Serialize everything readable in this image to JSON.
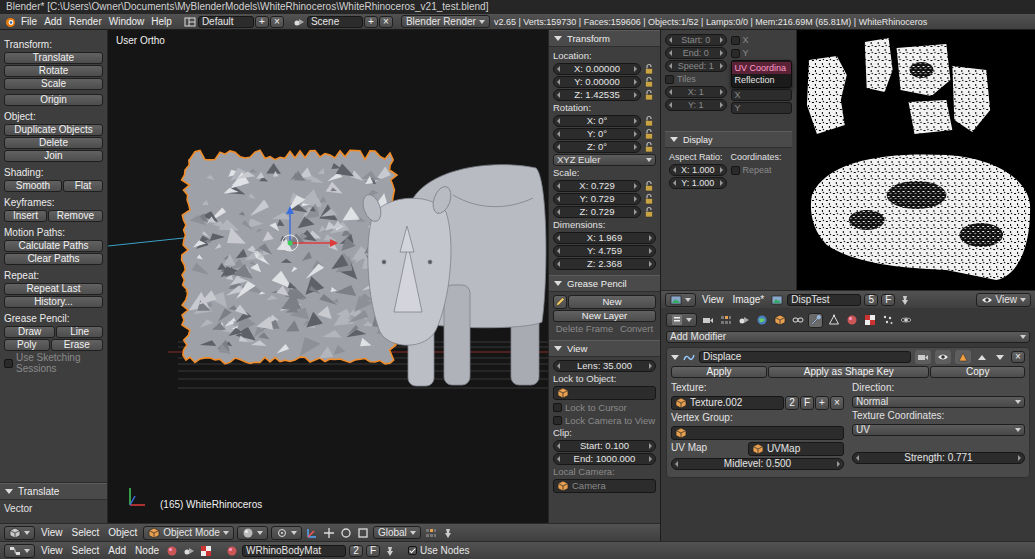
{
  "window": {
    "title": "Blender* [C:\\Users\\Owner\\Documents\\MyBlenderModels\\WhiteRhinoceros\\WhiteRhinoceros_v21_test.blend]"
  },
  "menubar": {
    "menus": [
      "File",
      "Add",
      "Render",
      "Window",
      "Help"
    ],
    "layout": "Default",
    "layout_add": "+",
    "layout_remove": "×",
    "scene": "Scene",
    "scene_add": "+",
    "scene_remove": "×",
    "engine": "Blender Render",
    "info": "v2.65 | Verts:159730 | Faces:159606 | Objects:1/52 | Lamps:0/0 | Mem:216.69M (65.81M) | WhiteRhinoceros"
  },
  "toolshelf": {
    "groups": [
      [
        [
          {
            "kind": "heading",
            "text": "Transform:",
            "disabled": false
          }
        ],
        [
          {
            "kind": "button",
            "text": "Translate",
            "disabled": false
          }
        ],
        [
          {
            "kind": "button",
            "text": "Rotate",
            "disabled": false
          }
        ],
        [
          {
            "kind": "button",
            "text": "Scale",
            "disabled": false
          }
        ]
      ],
      [
        [
          {
            "kind": "button",
            "text": "Origin",
            "disabled": false
          }
        ]
      ],
      [
        [
          {
            "kind": "heading",
            "text": "Object:",
            "disabled": false
          }
        ],
        [
          {
            "kind": "button",
            "text": "Duplicate Objects",
            "disabled": false
          }
        ],
        [
          {
            "kind": "button",
            "text": "Delete",
            "disabled": false
          }
        ],
        [
          {
            "kind": "button",
            "text": "Join",
            "disabled": false
          }
        ]
      ],
      [
        [
          {
            "kind": "heading",
            "text": "Shading:",
            "disabled": false
          }
        ],
        [
          {
            "kind": "button",
            "text": "Smooth",
            "disabled": false
          },
          {
            "kind": "button",
            "text": "Flat",
            "disabled": false
          }
        ]
      ],
      [
        [
          {
            "kind": "heading",
            "text": "Keyframes:",
            "disabled": false
          }
        ],
        [
          {
            "kind": "button",
            "text": "Insert",
            "disabled": false
          },
          {
            "kind": "button",
            "text": "Remove",
            "disabled": false
          }
        ]
      ],
      [
        [
          {
            "kind": "heading",
            "text": "Motion Paths:",
            "disabled": false
          }
        ],
        [
          {
            "kind": "button",
            "text": "Calculate Paths",
            "disabled": false
          }
        ],
        [
          {
            "kind": "button",
            "text": "Clear Paths",
            "disabled": false
          }
        ]
      ],
      [
        [
          {
            "kind": "heading",
            "text": "Repeat:",
            "disabled": false
          }
        ],
        [
          {
            "kind": "button",
            "text": "Repeat Last",
            "disabled": false
          }
        ],
        [
          {
            "kind": "button",
            "text": "History...",
            "disabled": false
          }
        ]
      ],
      [
        [
          {
            "kind": "heading",
            "text": "Grease Pencil:",
            "disabled": false
          }
        ],
        [
          {
            "kind": "button",
            "text": "Draw",
            "disabled": false
          },
          {
            "kind": "button",
            "text": "Line",
            "disabled": false
          }
        ],
        [
          {
            "kind": "button",
            "text": "Poly",
            "disabled": false
          },
          {
            "kind": "button",
            "text": "Erase",
            "disabled": false
          }
        ],
        [
          {
            "kind": "check",
            "text": "Use Sketching Sessions",
            "checked": false,
            "disabled": true
          }
        ]
      ]
    ],
    "operator_panel": {
      "title": "Translate",
      "expanded": true,
      "rows": [
        [
          {
            "kind": "label",
            "text": "Vector",
            "disabled": false
          }
        ]
      ]
    }
  },
  "viewport": {
    "view_name": "User Ortho",
    "object_label": "(165) WhiteRhinoceros"
  },
  "sidebar": {
    "panels": [
      {
        "title": "Transform",
        "expanded": true,
        "rows": [
          [
            {
              "kind": "label",
              "text": "Location:",
              "disabled": false
            }
          ],
          [
            {
              "kind": "number",
              "text": "X: 0.00000",
              "disabled": false,
              "locked": false
            }
          ],
          [
            {
              "kind": "number",
              "text": "Y: 0.00000",
              "disabled": false,
              "locked": false
            }
          ],
          [
            {
              "kind": "number",
              "text": "Z: 1.42535",
              "disabled": false,
              "locked": false
            }
          ],
          [
            {
              "kind": "label",
              "text": "Rotation:",
              "disabled": false
            }
          ],
          [
            {
              "kind": "number",
              "text": "X: 0°",
              "disabled": false,
              "locked": false
            }
          ],
          [
            {
              "kind": "number",
              "text": "Y: 0°",
              "disabled": false,
              "locked": false
            }
          ],
          [
            {
              "kind": "number",
              "text": "Z: 0°",
              "disabled": false,
              "locked": false
            }
          ],
          [
            {
              "kind": "menu",
              "text": "XYZ Euler",
              "disabled": false
            }
          ],
          [
            {
              "kind": "label",
              "text": "Scale:",
              "disabled": false
            }
          ],
          [
            {
              "kind": "number",
              "text": "X: 0.729",
              "disabled": false,
              "locked": false
            }
          ],
          [
            {
              "kind": "number",
              "text": "Y: 0.729",
              "disabled": false,
              "locked": false
            }
          ],
          [
            {
              "kind": "number",
              "text": "Z: 0.729",
              "disabled": false,
              "locked": false
            }
          ],
          [
            {
              "kind": "label",
              "text": "Dimensions:",
              "disabled": false
            }
          ],
          [
            {
              "kind": "number",
              "text": "X: 1.969",
              "disabled": false
            }
          ],
          [
            {
              "kind": "number",
              "text": "Y: 4.759",
              "disabled": false
            }
          ],
          [
            {
              "kind": "number",
              "text": "Z: 2.368",
              "disabled": false
            }
          ]
        ]
      },
      {
        "title": "Grease Pencil",
        "expanded": true,
        "rows": [
          [
            {
              "kind": "iconbutton",
              "disabled": false
            },
            {
              "kind": "button",
              "text": "New",
              "disabled": false
            }
          ],
          [
            {
              "kind": "button",
              "text": "New Layer",
              "disabled": false
            }
          ],
          [
            {
              "kind": "button",
              "text": "Delete Frame",
              "disabled": true
            },
            {
              "kind": "button",
              "text": "Convert",
              "disabled": true
            }
          ]
        ]
      },
      {
        "title": "View",
        "expanded": true,
        "rows": [
          [
            {
              "kind": "number",
              "text": "Lens: 35.000",
              "disabled": false
            }
          ],
          [
            {
              "kind": "label",
              "text": "Lock to Object:",
              "disabled": false
            }
          ],
          [
            {
              "kind": "idfield",
              "text": "",
              "disabled": false
            }
          ],
          [
            {
              "kind": "check",
              "text": "Lock to Cursor",
              "checked": false,
              "disabled": true
            }
          ],
          [
            {
              "kind": "check",
              "text": "Lock Camera to View",
              "checked": false,
              "disabled": true
            }
          ],
          [
            {
              "kind": "label",
              "text": "Clip:",
              "disabled": false
            }
          ],
          [
            {
              "kind": "number",
              "text": "Start: 0.100",
              "disabled": false
            }
          ],
          [
            {
              "kind": "number",
              "text": "End: 1000.000",
              "disabled": false
            }
          ],
          [
            {
              "kind": "label",
              "text": "Local Camera:",
              "disabled": true
            }
          ],
          [
            {
              "kind": "idfield",
              "text": "Camera",
              "disabled": true
            }
          ]
        ]
      }
    ]
  },
  "viewport_header": {
    "menus": [
      "View",
      "Select",
      "Object"
    ],
    "mode": "Object Mode",
    "orientation": "Global"
  },
  "image_panel": {
    "left": [
      [
        {
          "kind": "number",
          "text": "Start: 0",
          "disabled": true
        }
      ],
      [
        {
          "kind": "number",
          "text": "End: 0",
          "disabled": true
        }
      ],
      [
        {
          "kind": "number",
          "text": "Speed: 1",
          "disabled": true
        }
      ],
      [
        {
          "kind": "check",
          "text": "Tiles",
          "checked": false,
          "disabled": true
        }
      ],
      [
        {
          "kind": "number",
          "text": "X: 1",
          "disabled": true
        }
      ],
      [
        {
          "kind": "number",
          "text": "Y: 1",
          "disabled": true
        }
      ]
    ],
    "right": [
      [
        {
          "kind": "check",
          "text": "X",
          "checked": false,
          "disabled": true
        }
      ],
      [
        {
          "kind": "check",
          "text": "Y",
          "checked": false,
          "disabled": true
        }
      ],
      [
        {
          "kind": "popup",
          "items": [
            {
              "text": "UV Coordina",
              "selected": true
            },
            {
              "text": "Reflection",
              "selected": false
            }
          ]
        }
      ],
      [
        {
          "kind": "field",
          "text": "X",
          "disabled": true
        }
      ],
      [
        {
          "kind": "field",
          "text": "Y",
          "disabled": true
        }
      ]
    ],
    "display": {
      "title": "Display",
      "expanded": true,
      "left": [
        [
          {
            "kind": "label",
            "text": "Aspect Ratio:",
            "disabled": false
          }
        ],
        [
          {
            "kind": "number",
            "text": "X: 1.000",
            "disabled": false
          }
        ],
        [
          {
            "kind": "number",
            "text": "Y: 1.000",
            "disabled": false
          }
        ]
      ],
      "right": [
        [
          {
            "kind": "label",
            "text": "Coordinates:",
            "disabled": false
          }
        ],
        [
          {
            "kind": "check",
            "text": "Repeat",
            "checked": false,
            "disabled": true
          }
        ]
      ]
    }
  },
  "image_header": {
    "menus": [
      "View",
      "Image*"
    ],
    "image": "DispTest",
    "users": "5",
    "fake": "F",
    "display": "View"
  },
  "properties": {
    "tabs": [
      {
        "selected": false
      },
      {
        "selected": false
      },
      {
        "selected": false
      },
      {
        "selected": false
      },
      {
        "selected": false
      },
      {
        "selected": false
      },
      {
        "selected": true
      },
      {
        "selected": false
      },
      {
        "selected": false
      },
      {
        "selected": false
      },
      {
        "selected": false
      },
      {
        "selected": false
      }
    ],
    "add_modifier": "Add Modifier",
    "modifier": {
      "name": "Displace",
      "expanded": true,
      "toggles": [
        {
          "on": true
        },
        {
          "on": true
        },
        {
          "on": true
        }
      ],
      "remove": "×",
      "actions": [
        {
          "kind": "button",
          "text": "Apply",
          "disabled": false
        },
        {
          "kind": "button",
          "text": "Apply as Shape Key",
          "disabled": false
        },
        {
          "kind": "button",
          "text": "Copy",
          "disabled": false
        }
      ],
      "left": [
        [
          {
            "kind": "label",
            "text": "Texture:",
            "disabled": false
          }
        ],
        [
          {
            "kind": "idfield",
            "text": "Texture.002",
            "disabled": false
          },
          {
            "kind": "button",
            "text": "2",
            "disabled": false
          },
          {
            "kind": "button",
            "text": "F",
            "disabled": false
          },
          {
            "kind": "button",
            "text": "+",
            "disabled": false
          },
          {
            "kind": "button",
            "text": "×",
            "disabled": false
          }
        ],
        [
          {
            "kind": "label",
            "text": "Vertex Group:",
            "disabled": false
          }
        ],
        [
          {
            "kind": "idfield",
            "text": "",
            "disabled": false
          }
        ],
        [
          {
            "kind": "label",
            "text": "UV Map",
            "disabled": false
          },
          {
            "kind": "idfield",
            "text": "UVMap",
            "disabled": false
          }
        ],
        [
          {
            "kind": "number",
            "text": "Midlevel: 0.500",
            "disabled": false
          }
        ]
      ],
      "right": [
        [
          {
            "kind": "label",
            "text": "Direction:",
            "disabled": false
          }
        ],
        [
          {
            "kind": "menu",
            "text": "Normal",
            "disabled": false
          }
        ],
        [
          {
            "kind": "label",
            "text": "Texture Coordinates:",
            "disabled": false
          }
        ],
        [
          {
            "kind": "menu",
            "text": "UV",
            "disabled": false
          }
        ],
        [],
        [
          {
            "kind": "number",
            "text": "Strength: 0.771",
            "disabled": false
          }
        ]
      ]
    }
  },
  "node_header": {
    "menus": [
      "View",
      "Select",
      "Add",
      "Node"
    ],
    "material": "WRhinoBodyMat",
    "users": "2",
    "fake": "F",
    "use_nodes": {
      "text": "Use Nodes",
      "checked": true
    }
  }
}
